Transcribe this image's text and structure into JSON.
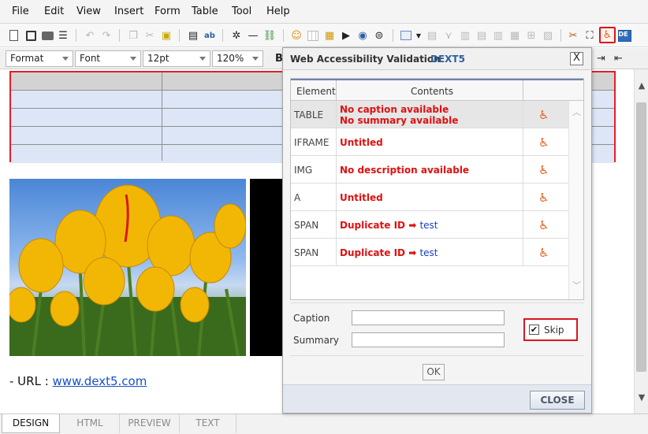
{
  "menu": [
    "File",
    "Edit",
    "View",
    "Insert",
    "Form",
    "Table",
    "Tool",
    "Help"
  ],
  "toolbar_format": {
    "format": "Format",
    "font": "Font",
    "size": "12pt",
    "zoom": "120%",
    "bold": "B"
  },
  "editor": {
    "url_prefix": "- URL : ",
    "url_link": "www.dext5.com"
  },
  "dialog": {
    "title": "Web Accessibility Validation",
    "brand": "DEXT5",
    "close_x": "X",
    "columns": {
      "element": "Element",
      "contents": "Contents"
    },
    "rows": [
      {
        "element": "TABLE",
        "line1": "No caption available",
        "line2": "No summary available"
      },
      {
        "element": "IFRAME",
        "line1": "Untitled"
      },
      {
        "element": "IMG",
        "line1": "No description available"
      },
      {
        "element": "A",
        "line1": "Untitled"
      },
      {
        "element": "SPAN",
        "line1": "Duplicate ID",
        "arrow": "➡",
        "value": "test"
      },
      {
        "element": "SPAN",
        "line1": "Duplicate ID",
        "arrow": "➡",
        "value": "test"
      }
    ],
    "caption_label": "Caption",
    "summary_label": "Summary",
    "caption_value": "",
    "summary_value": "",
    "skip_label": "Skip",
    "skip_checked": true,
    "ok_label": "OK",
    "close_label": "CLOSE"
  },
  "tabs": [
    "DESIGN",
    "HTML",
    "PREVIEW",
    "TEXT"
  ],
  "active_tab": "DESIGN",
  "colors": {
    "error_text": "#e01010",
    "highlight_border": "#d9161c",
    "link": "#1a4fc4",
    "brand_blue": "#2f5f9a"
  }
}
